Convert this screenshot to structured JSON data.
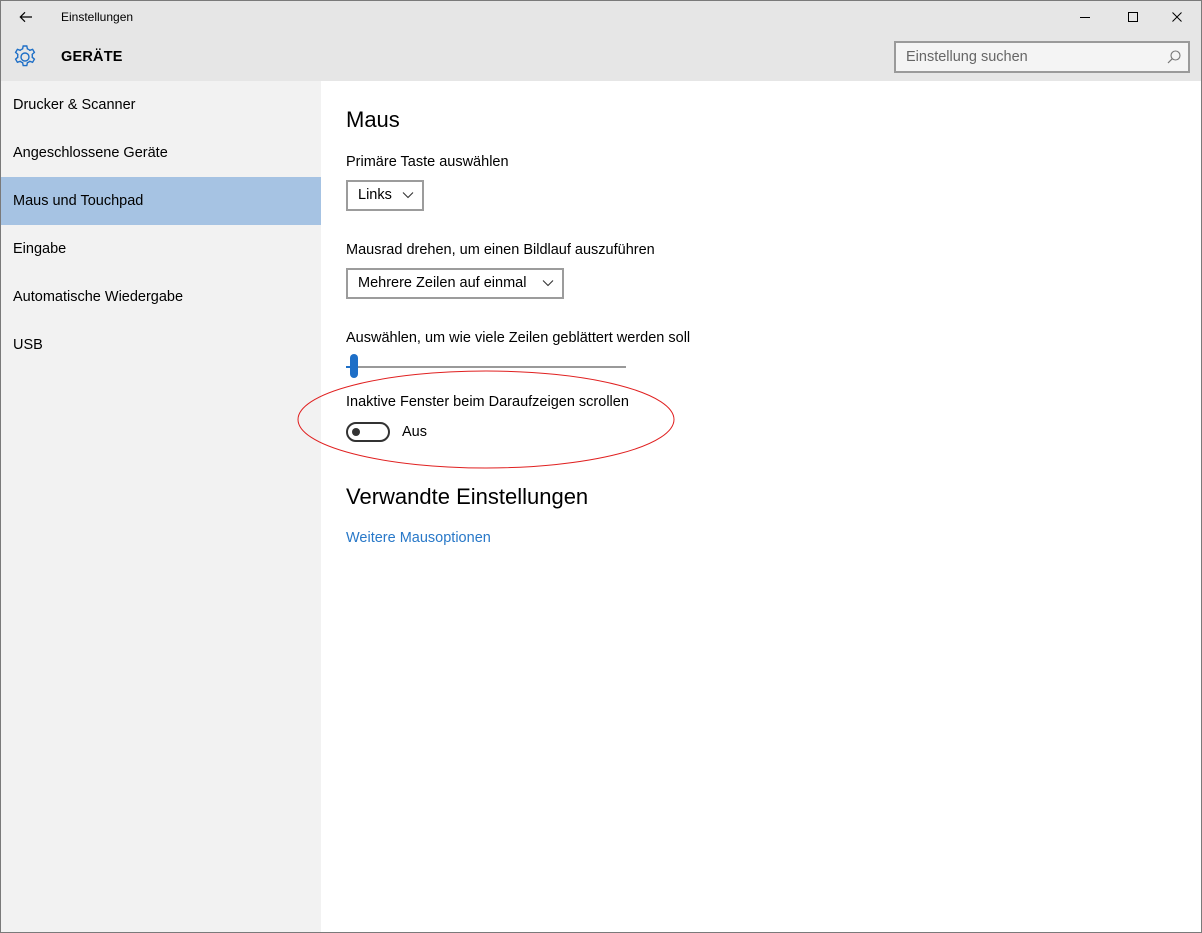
{
  "window": {
    "title": "Einstellungen"
  },
  "header": {
    "section": "GERÄTE",
    "search_placeholder": "Einstellung suchen"
  },
  "sidebar": {
    "items": [
      {
        "label": "Drucker & Scanner"
      },
      {
        "label": "Angeschlossene Geräte"
      },
      {
        "label": "Maus und Touchpad",
        "active": true
      },
      {
        "label": "Eingabe"
      },
      {
        "label": "Automatische Wiedergabe"
      },
      {
        "label": "USB"
      }
    ]
  },
  "main": {
    "title": "Maus",
    "primary_button": {
      "label": "Primäre Taste auswählen",
      "value": "Links"
    },
    "scroll_mode": {
      "label": "Mausrad drehen, um einen Bildlauf auszuführen",
      "value": "Mehrere Zeilen auf einmal"
    },
    "lines_to_scroll": {
      "label": "Auswählen, um wie viele Zeilen geblättert werden soll",
      "level": 0.03
    },
    "inactive_scroll": {
      "label": "Inaktive Fenster beim Daraufzeigen scrollen",
      "state": "Aus",
      "on": false
    },
    "related": {
      "title": "Verwandte Einstellungen",
      "link": "Weitere Mausoptionen"
    }
  },
  "colors": {
    "chrome_bg": "#e6e6e6",
    "sidebar_bg": "#f2f2f2",
    "active_item": "#a6c3e3",
    "accent": "#1e6fc7",
    "link": "#2878c8",
    "annotation": "#e02020"
  },
  "icons": {
    "back": "back-arrow-icon",
    "settings": "gear-icon",
    "search": "search-icon",
    "minimize": "minimize-icon",
    "maximize": "maximize-icon",
    "close": "close-icon"
  }
}
